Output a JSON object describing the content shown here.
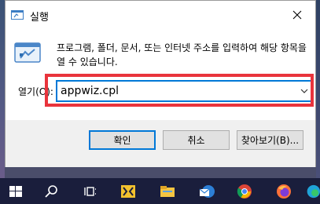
{
  "dialog": {
    "title": "실행",
    "description": "프로그램, 폴더, 문서, 또는 인터넷 주소를 입력하여 해당 항목을 열 수 있습니다.",
    "open_label": "열기(O):",
    "open_value": "appwiz.cpl",
    "ok_label": "확인",
    "cancel_label": "취소",
    "browse_label": "찾아보기(B)..."
  },
  "taskbar": {
    "items": [
      "start-icon",
      "search-icon",
      "task-view-icon",
      "app-icon",
      "file-explorer-icon",
      "mail-icon",
      "chrome-icon",
      "firefox-icon",
      "edge-icon"
    ]
  },
  "colors": {
    "accent": "#0078d7",
    "highlight": "#e9343c",
    "taskbar": "#1a1e3c"
  }
}
